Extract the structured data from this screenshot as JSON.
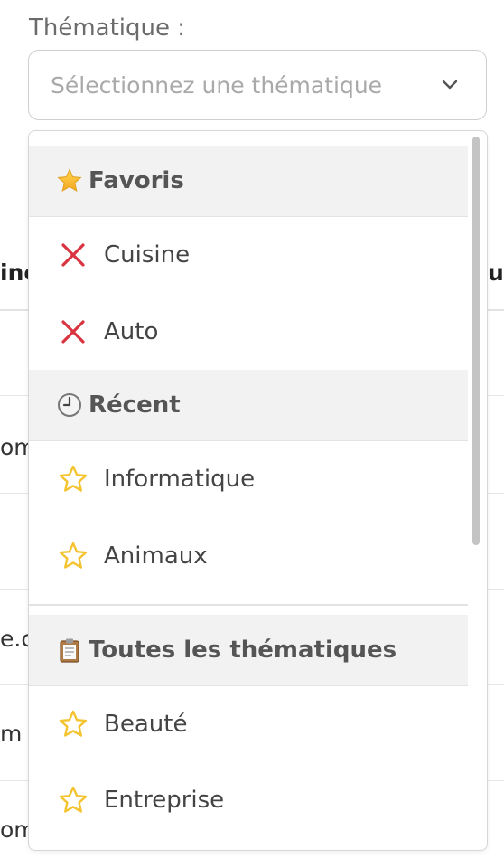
{
  "field": {
    "label": "Thématique :",
    "placeholder": "Sélectionnez une thématique"
  },
  "background": {
    "header_left": "ine",
    "header_right": "ue",
    "rows": [
      "om",
      "",
      "e.c",
      "m",
      "om"
    ]
  },
  "dropdown": {
    "groups": [
      {
        "title": "Favoris",
        "icon": "star-filled-icon",
        "items": [
          {
            "label": "Cuisine",
            "icon": "remove-x-icon"
          },
          {
            "label": "Auto",
            "icon": "remove-x-icon"
          }
        ]
      },
      {
        "title": "Récent",
        "icon": "clock-icon",
        "items": [
          {
            "label": "Informatique",
            "icon": "star-outline-icon"
          },
          {
            "label": "Animaux",
            "icon": "star-outline-icon"
          }
        ]
      },
      {
        "title": "Toutes les thématiques",
        "icon": "clipboard-icon",
        "items": [
          {
            "label": "Beauté",
            "icon": "star-outline-icon"
          },
          {
            "label": "Entreprise",
            "icon": "star-outline-icon"
          }
        ]
      }
    ]
  },
  "colors": {
    "remove_x": "#d9343f",
    "star_outline": "#f4c430",
    "group_bg": "#f2f2f2"
  }
}
